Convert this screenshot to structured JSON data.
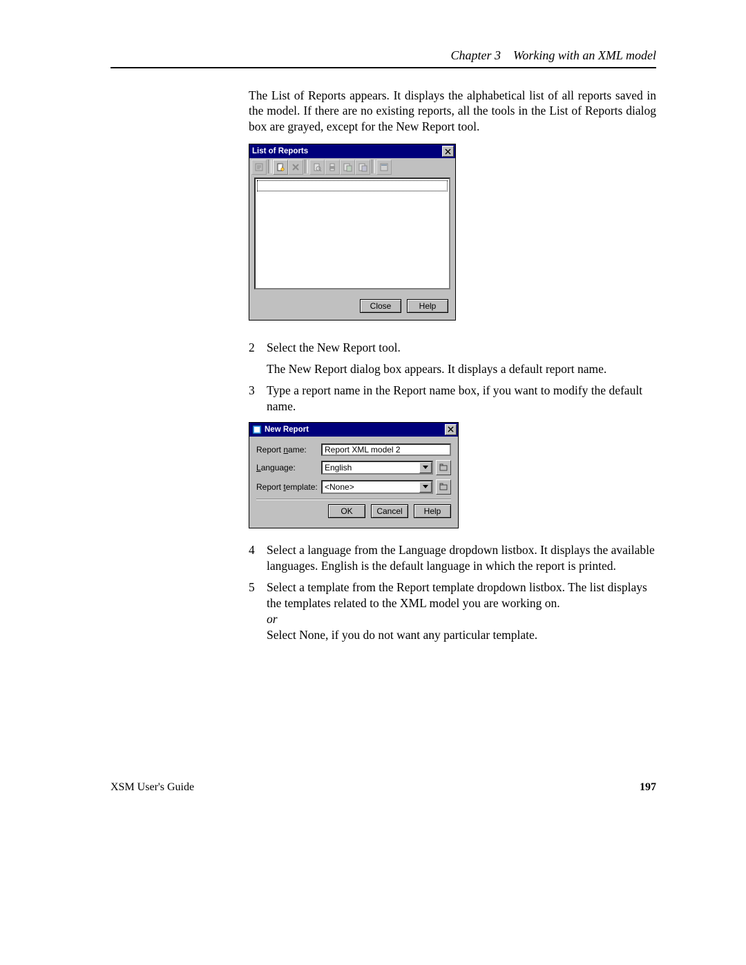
{
  "header": {
    "chapter": "Chapter 3",
    "title": "Working with an XML model"
  },
  "intro": "The List of Reports appears. It displays the alphabetical list of all reports saved in the model. If there are no existing reports, all the tools in the List of Reports dialog box are grayed, except for the New Report tool.",
  "dlg1": {
    "title": "List of Reports",
    "btn_close": "Close",
    "btn_help": "Help"
  },
  "steps": {
    "s2_num": "2",
    "s2_text": "Select the New Report tool.",
    "s2_sub": "The New Report dialog box appears. It displays a default report name.",
    "s3_num": "3",
    "s3_text": "Type a report name in the Report name box, if you want to modify the default name.",
    "s4_num": "4",
    "s4_text": "Select a language from the Language dropdown listbox. It displays the available languages. English is the default language in which the report is printed.",
    "s5_num": "5",
    "s5_text_a": "Select a template from the Report template dropdown listbox. The list displays the templates related to the XML model you are working on.",
    "s5_or": "or",
    "s5_text_b": "Select None, if you do not want any particular template."
  },
  "dlg2": {
    "title": "New Report",
    "lbl_name_pre": "Report ",
    "lbl_name_ul": "n",
    "lbl_name_post": "ame:",
    "val_name": "Report XML model 2",
    "lbl_lang_ul": "L",
    "lbl_lang_post": "anguage:",
    "val_lang": "English",
    "lbl_tmpl_pre": "Report ",
    "lbl_tmpl_ul": "t",
    "lbl_tmpl_post": "emplate:",
    "val_tmpl": "<None>",
    "btn_ok": "OK",
    "btn_cancel": "Cancel",
    "btn_help": "Help"
  },
  "footer": {
    "left": "XSM User's Guide",
    "page": "197"
  }
}
